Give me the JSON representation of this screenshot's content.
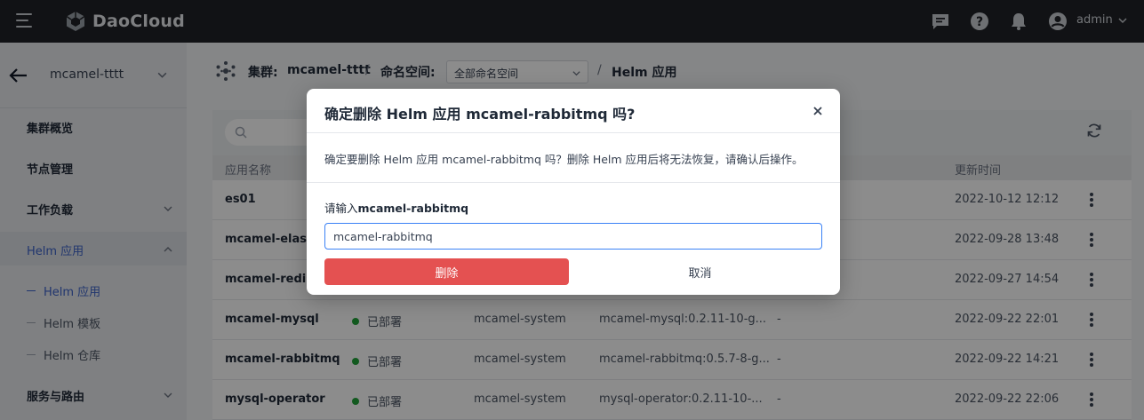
{
  "topbar": {
    "brand": "DaoCloud",
    "user": "admin",
    "icons": [
      "menu-icon",
      "message-icon",
      "help-icon",
      "bell-icon",
      "user-icon"
    ]
  },
  "sidebar": {
    "cluster": "mcamel-tttt",
    "items": [
      {
        "label": "集群概览"
      },
      {
        "label": "节点管理"
      },
      {
        "label": "工作负载"
      },
      {
        "label": "Helm 应用"
      },
      {
        "label": "服务与路由"
      }
    ],
    "helm_sub": [
      {
        "label": "Helm 应用"
      },
      {
        "label": "Helm 模板"
      },
      {
        "label": "Helm 仓库"
      }
    ]
  },
  "breadcrumb": {
    "cluster_label": "集群:",
    "cluster": "mcamel-tttt",
    "sep1": "/",
    "ns_label": "命名空间:",
    "ns_value": "全部命名空间",
    "sep2": "/",
    "page": "Helm 应用"
  },
  "table": {
    "columns": {
      "name": "应用名称",
      "time": "更新时间"
    },
    "rows": [
      {
        "name": "es01",
        "status": "",
        "ns": "",
        "chart": "",
        "desc": "",
        "time": "2022-10-12 12:12"
      },
      {
        "name": "mcamel-elastic",
        "status": "",
        "ns": "",
        "chart": "",
        "desc": "",
        "time": "2022-09-28 13:48"
      },
      {
        "name": "mcamel-redis",
        "status": "",
        "ns": "",
        "chart": "",
        "desc": "",
        "time": "2022-09-27 14:54"
      },
      {
        "name": "mcamel-mysql",
        "status": "已部署",
        "ns": "mcamel-system",
        "chart": "mcamel-mysql:0.2.11-10-g...",
        "desc": "-",
        "time": "2022-09-22 22:01"
      },
      {
        "name": "mcamel-rabbitmq",
        "status": "已部署",
        "ns": "mcamel-system",
        "chart": "mcamel-rabbitmq:0.5.7-8-g...",
        "desc": "-",
        "time": "2022-09-22 14:21"
      },
      {
        "name": "mysql-operator",
        "status": "已部署",
        "ns": "mcamel-system",
        "chart": "mysql-operator:0.2.11-10-...",
        "desc": "-",
        "time": "2022-09-22 22:06"
      }
    ]
  },
  "modal": {
    "title": "确定删除 Helm 应用 mcamel-rabbitmq 吗?",
    "description": "确定要删除 Helm 应用 mcamel-rabbitmq 吗？删除 Helm 应用后将无法恢复，请确认后操作。",
    "label_prefix": "请输入",
    "label_name": "mcamel-rabbitmq",
    "input_value": "mcamel-rabbitmq",
    "delete_label": "删除",
    "cancel_label": "取消"
  }
}
